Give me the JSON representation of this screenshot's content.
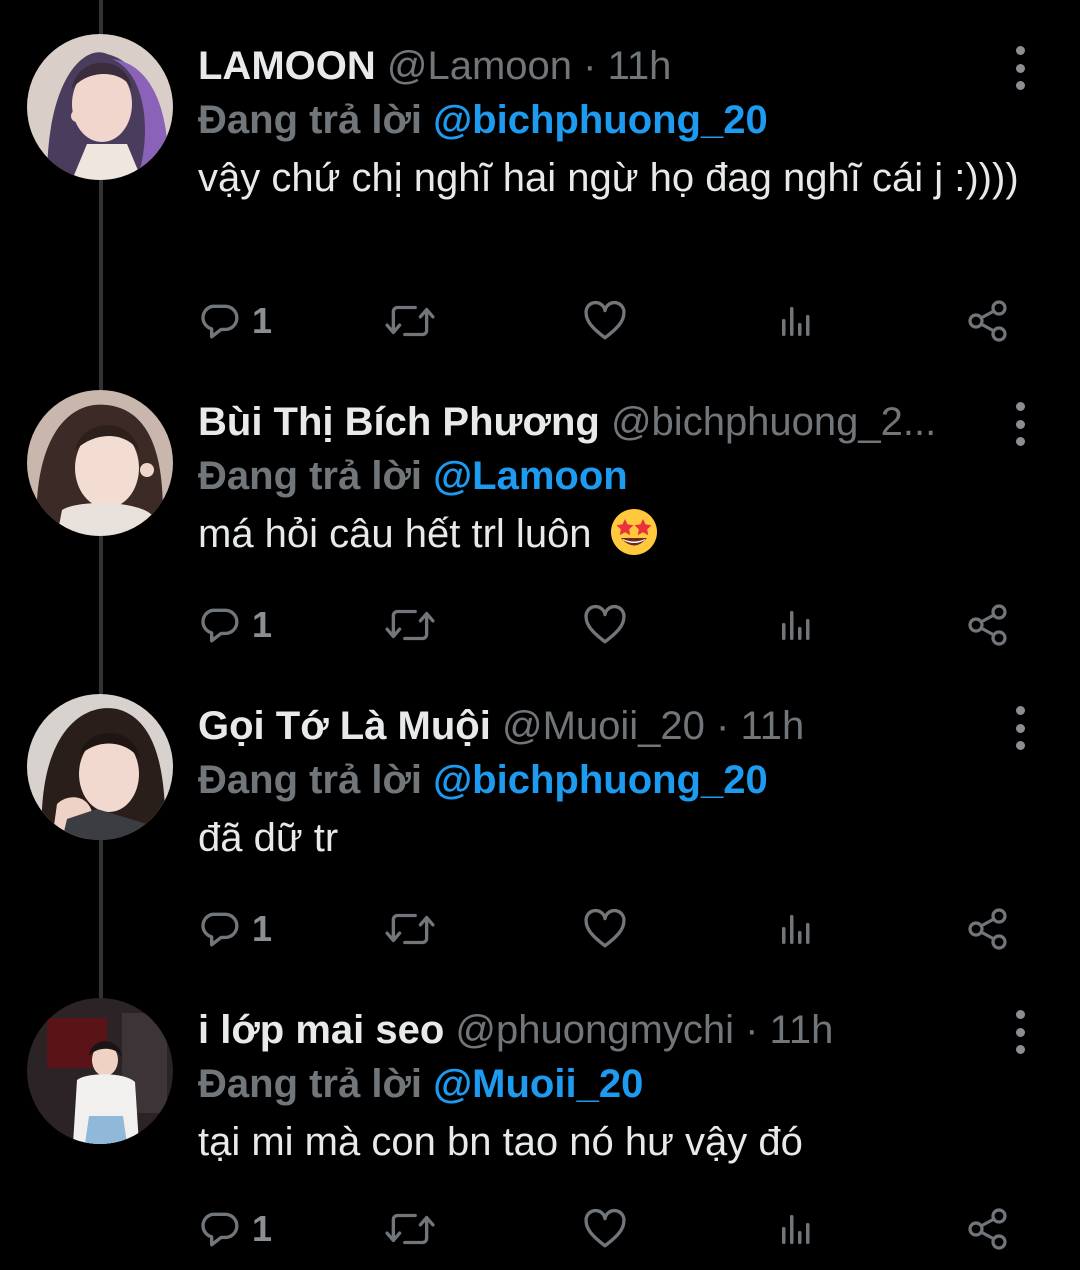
{
  "tweets": [
    {
      "name": "LAMOON",
      "handle": "@Lamoon",
      "separator": "·",
      "time": "11h",
      "reply_prefix": "Đang trả lời",
      "reply_to": "@bichphuong_20",
      "text": "vậy chứ chị nghĩ hai ngừ họ đag nghĩ cái j :))))",
      "reply_count": "1"
    },
    {
      "name": "Bùi Thị Bích Phương",
      "handle": "@bichphuong_2...",
      "separator": "",
      "time": "",
      "reply_prefix": "Đang trả lời",
      "reply_to": "@Lamoon",
      "text": "má hỏi câu hết trl luôn",
      "emoji": "star-struck-emoji",
      "reply_count": "1"
    },
    {
      "name": "Gọi Tớ Là Muội",
      "handle": "@Muoii_20",
      "separator": "·",
      "time": "11h",
      "reply_prefix": "Đang trả lời",
      "reply_to": "@bichphuong_20",
      "text": "đã dữ tr",
      "reply_count": "1"
    },
    {
      "name": "i lớp mai seo",
      "handle": "@phuongmychi",
      "separator": "·",
      "time": "11h",
      "reply_prefix": "Đang trả lời",
      "reply_to": "@Muoii_20",
      "text": "tại mi mà con bn tao nó hư vậy đó",
      "reply_count": "1"
    }
  ],
  "icons": {
    "reply": "reply-icon",
    "retweet": "retweet-icon",
    "like": "heart-icon",
    "views": "views-icon",
    "share": "share-icon",
    "more": "more-icon"
  },
  "colors": {
    "background": "#000000",
    "text": "#e7e9ea",
    "muted": "#71767b",
    "mention": "#1d9bf0",
    "thread_line": "#2f3336"
  }
}
